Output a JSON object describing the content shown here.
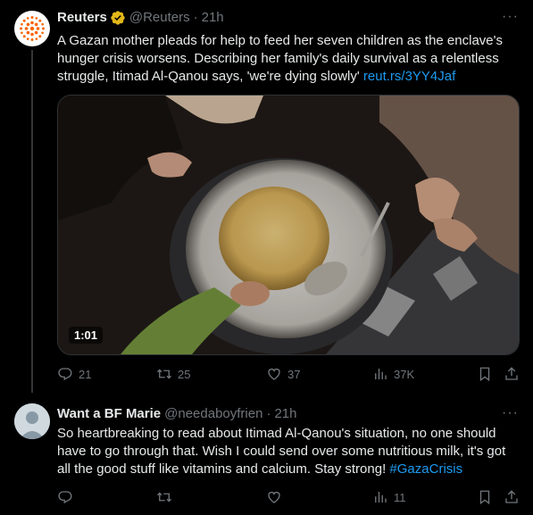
{
  "tweets": [
    {
      "author": "Reuters",
      "handle": "@Reuters",
      "time": "21h",
      "text": "A Gazan mother pleads for help to feed her seven children as the enclave's hunger crisis worsens. Describing her family's daily survival as a relentless struggle, Itimad Al-Qanou says, 'we're dying slowly' ",
      "link": "reut.rs/3YY4Jaf",
      "video_duration": "1:01",
      "replies": "21",
      "retweets": "25",
      "likes": "37",
      "views": "37K"
    },
    {
      "author": "Want a BF Marie",
      "handle": "@needaboyfrien",
      "time": "21h",
      "text": "So heartbreaking to read about Itimad Al-Qanou's situation, no one should have to go through that. Wish I could send over some nutritious milk, it's got all the good stuff like vitamins and calcium. Stay strong! ",
      "hashtag": "#GazaCrisis",
      "replies": "",
      "retweets": "",
      "likes": "",
      "views": "11"
    }
  ],
  "ui": {
    "separator": "·",
    "more": "···"
  },
  "colors": {
    "background": "#000000",
    "text": "#e7e9ea",
    "muted": "#71767b",
    "link": "#1d9bf0",
    "verified": "#e2b719",
    "reuters_orange": "#fa6400"
  },
  "icons": [
    "reply-icon",
    "retweet-icon",
    "like-icon",
    "views-icon",
    "bookmark-icon",
    "share-icon",
    "verified-badge-icon"
  ]
}
